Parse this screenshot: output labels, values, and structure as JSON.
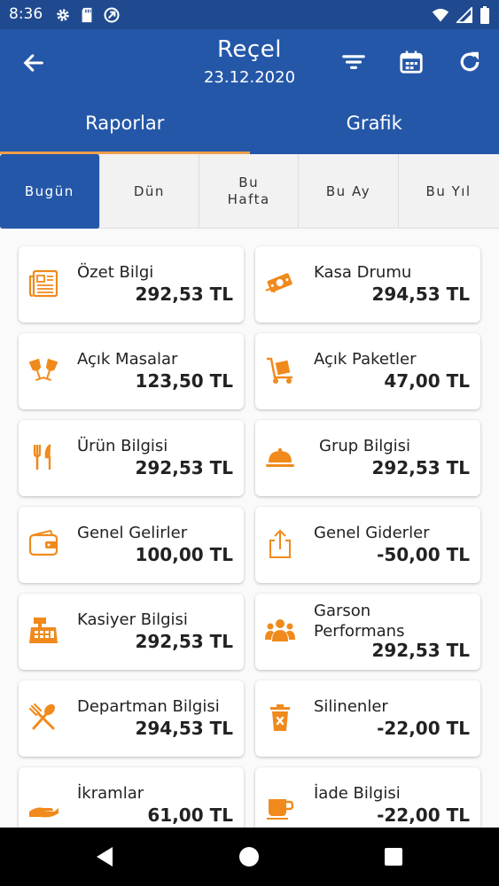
{
  "status": {
    "time": "8:36"
  },
  "header": {
    "title": "Reçel",
    "date": "23.12.2020"
  },
  "tabs": [
    {
      "label": "Raporlar"
    },
    {
      "label": "Grafik"
    }
  ],
  "periods": [
    {
      "label": "Bugün"
    },
    {
      "label": "Dün"
    },
    {
      "label": "Bu Hafta"
    },
    {
      "label": "Bu Ay"
    },
    {
      "label": "Bu Yıl"
    }
  ],
  "cards": [
    {
      "label": "Özet Bilgi",
      "value": "292,53 TL",
      "icon": "newspaper-icon"
    },
    {
      "label": "Kasa Drumu",
      "value": "294,53 TL",
      "icon": "money-icon"
    },
    {
      "label": "Açık Masalar",
      "value": "123,50 TL",
      "icon": "glasses-toast-icon"
    },
    {
      "label": "Açık Paketler",
      "value": "47,00 TL",
      "icon": "dolly-box-icon"
    },
    {
      "label": "Ürün Bilgisi",
      "value": "292,53 TL",
      "icon": "cutlery-icon"
    },
    {
      "label": "Grup Bilgisi",
      "value": "292,53 TL",
      "icon": "cloche-icon"
    },
    {
      "label": "Genel Gelirler",
      "value": "100,00 TL",
      "icon": "wallet-icon"
    },
    {
      "label": "Genel Giderler",
      "value": "-50,00 TL",
      "icon": "upload-share-icon"
    },
    {
      "label": "Kasiyer Bilgisi",
      "value": "292,53 TL",
      "icon": "cash-register-icon"
    },
    {
      "label": "Garson Performans",
      "value": "292,53 TL",
      "icon": "users-group-icon"
    },
    {
      "label": "Departman Bilgisi",
      "value": "294,53 TL",
      "icon": "spoon-fork-cross-icon"
    },
    {
      "label": "Silinenler",
      "value": "-22,00 TL",
      "icon": "trash-icon"
    },
    {
      "label": "İkramlar",
      "value": "61,00 TL",
      "icon": "hand-offer-icon"
    },
    {
      "label": "İade Bilgisi",
      "value": "-22,00 TL",
      "icon": "cup-icon"
    }
  ],
  "colors": {
    "primary": "#2457a8",
    "statusbar": "#204a8f",
    "accent": "#f0a04b"
  }
}
